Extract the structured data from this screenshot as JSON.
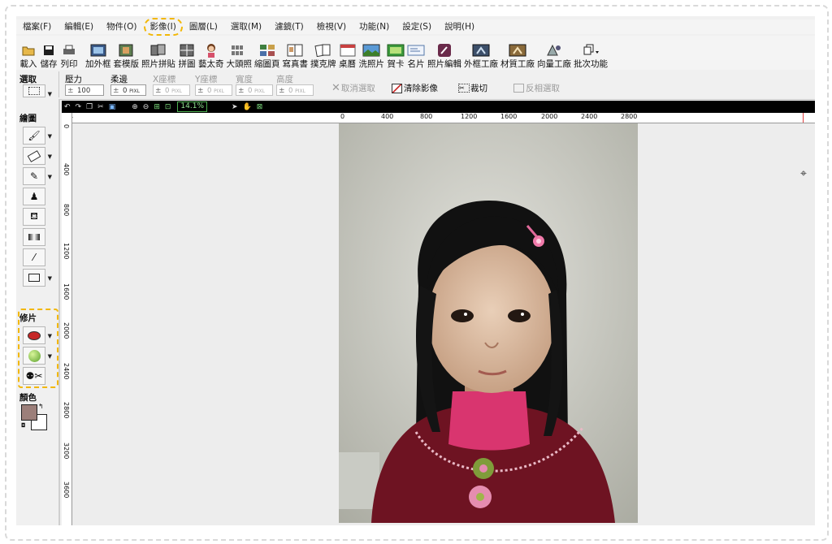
{
  "menu": [
    "檔案(F)",
    "編輯(E)",
    "物件(O)",
    "影像(I)",
    "圖層(L)",
    "選取(M)",
    "濾鏡(T)",
    "檢視(V)",
    "功能(N)",
    "設定(S)",
    "說明(H)"
  ],
  "menu_highlight_index": 3,
  "toolbar": [
    {
      "label": "載入",
      "icon": "open-folder-icon"
    },
    {
      "label": "儲存",
      "icon": "save-disk-icon"
    },
    {
      "label": "列印",
      "icon": "printer-icon"
    },
    {
      "label": "加外框",
      "icon": "frame-icon"
    },
    {
      "label": "套模版",
      "icon": "template-icon"
    },
    {
      "label": "照片拼貼",
      "icon": "collage-icon"
    },
    {
      "label": "拼圖",
      "icon": "puzzle-icon"
    },
    {
      "label": "藝太奇",
      "icon": "art-girl-icon"
    },
    {
      "label": "大頭照",
      "icon": "id-photo-icon"
    },
    {
      "label": "縮圖頁",
      "icon": "thumbnail-icon"
    },
    {
      "label": "寫真書",
      "icon": "photobook-icon"
    },
    {
      "label": "撲克牌",
      "icon": "poker-icon"
    },
    {
      "label": "桌曆",
      "icon": "calendar-icon"
    },
    {
      "label": "洗照片",
      "icon": "print-photo-icon"
    },
    {
      "label": "賀卡",
      "icon": "greeting-card-icon"
    },
    {
      "label": "名片",
      "icon": "business-card-icon"
    },
    {
      "label": "照片編輯",
      "icon": "photo-edit-icon"
    },
    {
      "label": "外框工廠",
      "icon": "frame-factory-icon"
    },
    {
      "label": "材質工廠",
      "icon": "texture-factory-icon"
    },
    {
      "label": "向量工廠",
      "icon": "vector-factory-icon"
    },
    {
      "label": "批次功能",
      "icon": "batch-icon"
    }
  ],
  "options": {
    "select_label": "選取",
    "pressure_label": "壓力",
    "pressure_value": "100",
    "feather_label": "柔邊",
    "feather_value": "0",
    "x_label": "X座標",
    "x_value": "0",
    "y_label": "Y座標",
    "y_value": "0",
    "width_label": "寬度",
    "width_value": "0",
    "height_label": "高度",
    "height_value": "0",
    "unit": "PIXL",
    "cancel_select": "取消選取",
    "clear_image": "清除影像",
    "crop": "裁切",
    "invert_select": "反相選取"
  },
  "left_panel": {
    "draw_label": "繪圖",
    "retouch_label": "修片",
    "color_label": "顏色",
    "fg_color": "#9c7f7a",
    "bg_color": "#ffffff"
  },
  "viewbar": {
    "zoom": "14.1%"
  },
  "ruler_top": [
    "0",
    "400",
    "800",
    "1200",
    "1600",
    "2000",
    "2400",
    "2800"
  ],
  "ruler_left": [
    "0",
    "400",
    "800",
    "1200",
    "1600",
    "2000",
    "2400",
    "2800",
    "3200",
    "3600"
  ]
}
